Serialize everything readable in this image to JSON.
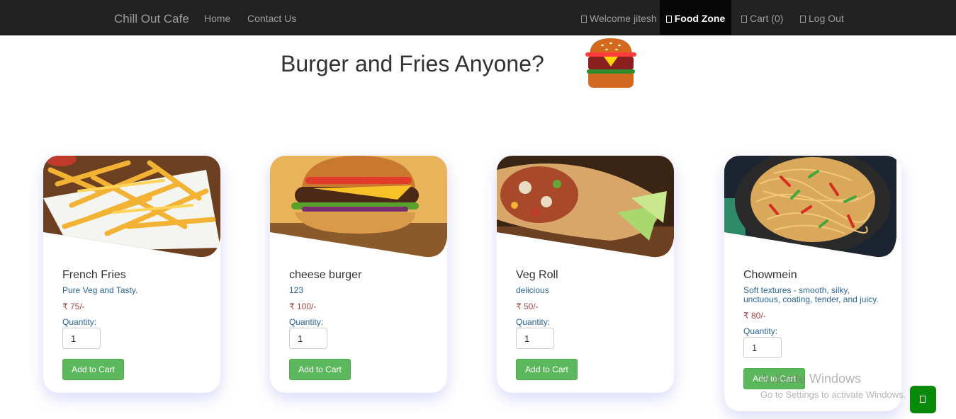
{
  "navbar": {
    "brand": "Chill Out Cafe",
    "home": "Home",
    "contact": "Contact Us",
    "welcome": "Welcome jitesh",
    "food_zone": "Food Zone",
    "cart": "Cart (0)",
    "logout": "Log Out"
  },
  "page": {
    "title": "Burger and Fries Anyone?"
  },
  "products": [
    {
      "name": "French Fries",
      "description": "Pure Veg and Tasty.",
      "price": "₹ 75/-",
      "quantity_label": "Quantity:",
      "quantity": "1",
      "button": "Add to Cart"
    },
    {
      "name": "cheese burger",
      "description": "123",
      "price": "₹ 100/-",
      "quantity_label": "Quantity:",
      "quantity": "1",
      "button": "Add to Cart"
    },
    {
      "name": "Veg Roll",
      "description": "delicious",
      "price": "₹ 50/-",
      "quantity_label": "Quantity:",
      "quantity": "1",
      "button": "Add to Cart"
    },
    {
      "name": "Chowmein",
      "description": "Soft textures - smooth, silky, unctuous, coating, tender, and juicy.",
      "price": "₹ 80/-",
      "quantity_label": "Quantity:",
      "quantity": "1",
      "button": "Add to Cart"
    }
  ],
  "watermark": {
    "title": "Activate Windows",
    "subtitle": "Go to Settings to activate Windows."
  },
  "colors": {
    "navbar": "#222222",
    "active_nav": "#080808",
    "button": "#5cb85c",
    "price": "#a94442",
    "float_button": "#0a8a0a"
  }
}
